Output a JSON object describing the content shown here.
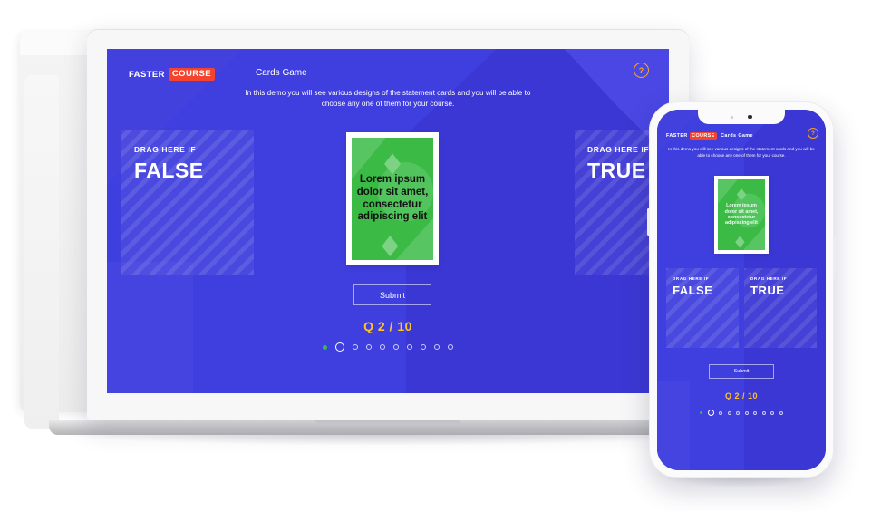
{
  "brand": {
    "word1": "FASTER",
    "word2": "COURSE"
  },
  "header": {
    "title": "Cards Game",
    "description": "In this demo you will see various designs of the statement cards and you will be able to choose any one of them for your course.",
    "help_label": "?",
    "help_icon": "question-mark-icon"
  },
  "dropzones": [
    {
      "label": "DRAG HERE IF",
      "value": "FALSE"
    },
    {
      "label": "DRAG HERE IF",
      "value": "TRUE"
    }
  ],
  "card": {
    "text": "Lorem ipsum dolor sit amet, consectetur adipiscing elit"
  },
  "actions": {
    "submit_label": "Submit"
  },
  "progress": {
    "counter": "Q 2 / 10",
    "total": 10,
    "current_index": 2,
    "dots": [
      "done",
      "current",
      "todo",
      "todo",
      "todo",
      "todo",
      "todo",
      "todo",
      "todo",
      "todo"
    ]
  },
  "colors": {
    "bg_blue": "#3F3FDF",
    "bg_blue_dark": "#3B37D4",
    "bg_blue_light": "#4A47E4",
    "badge_red": "#F4442E",
    "card_green": "#3BBA45",
    "card_green_light": "#56C45F",
    "accent_yellow": "#FFC328",
    "help_orange": "#F5A623"
  }
}
